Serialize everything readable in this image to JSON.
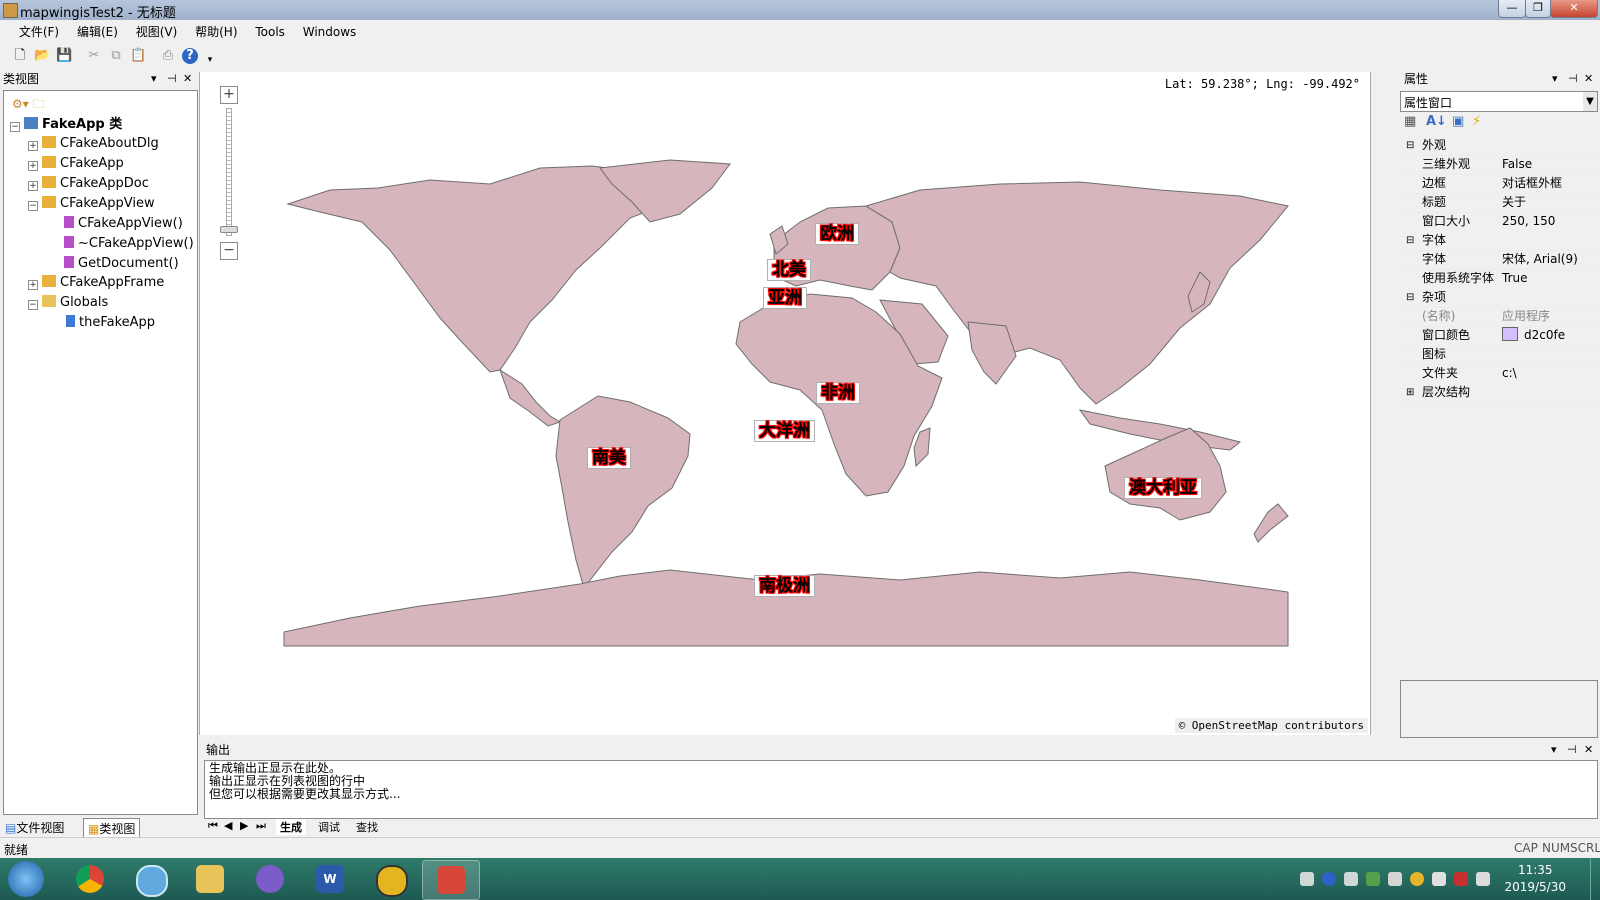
{
  "window": {
    "title": "mapwingisTest2 - 无标题",
    "min": "0",
    "max": "1",
    "close": "r"
  },
  "menu": [
    "文件(F)",
    "编辑(E)",
    "视图(V)",
    "帮助(H)",
    "Tools",
    "Windows"
  ],
  "class_view": {
    "title": "类视图",
    "root": "FakeApp 类",
    "items": [
      "CFakeAboutDlg",
      "CFakeApp",
      "CFakeAppDoc",
      "CFakeAppView",
      "CFakeAppView()",
      "~CFakeAppView()",
      "GetDocument()",
      "CFakeAppFrame",
      "Globals",
      "theFakeApp"
    ],
    "tabs": [
      "文件视图",
      "类视图"
    ]
  },
  "map": {
    "coords": "Lat: 59.238°; Lng: -99.492°",
    "attribution": "© OpenStreetMap contributors",
    "zoom_in": "+",
    "zoom_out": "−",
    "land_color": "#d6b6bc",
    "labels": {
      "europe": "欧洲",
      "north_america": "北美",
      "asia": "亚洲",
      "africa": "非洲",
      "oceania": "大洋洲",
      "south_america": "南美",
      "australia": "澳大利亚",
      "antarctica": "南极洲"
    }
  },
  "properties": {
    "title": "属性",
    "dropdown": "属性窗口",
    "rows": [
      {
        "k": "外观",
        "cat": true
      },
      {
        "k": "三维外观",
        "v": "False"
      },
      {
        "k": "边框",
        "v": "对话框外框"
      },
      {
        "k": "标题",
        "v": "关于"
      },
      {
        "k": "窗口大小",
        "v": "250, 150"
      },
      {
        "k": "字体",
        "cat": true
      },
      {
        "k": "字体",
        "v": "宋体, Arial(9)"
      },
      {
        "k": "使用系统字体",
        "v": "True"
      },
      {
        "k": "杂项",
        "cat": true
      },
      {
        "k": "(名称)",
        "v": "应用程序"
      },
      {
        "k": "窗口颜色",
        "v": "d2c0fe"
      },
      {
        "k": "图标",
        "v": ""
      },
      {
        "k": "文件夹",
        "v": "c:\\"
      },
      {
        "k": "层次结构",
        "cat": true
      }
    ],
    "swatch_color": "#d2c0fe"
  },
  "output": {
    "title": "输出",
    "lines": [
      "生成输出正显示在此处。",
      "输出正显示在列表视图的行中",
      "但您可以根据需要更改其显示方式..."
    ],
    "tabs": [
      "生成",
      "调试",
      "查找"
    ]
  },
  "status": {
    "text": "就绪",
    "cap": "CAP",
    "num": "NUM",
    "scrl": "SCRL"
  },
  "clock": {
    "time": "11:35",
    "date": "2019/5/30"
  }
}
